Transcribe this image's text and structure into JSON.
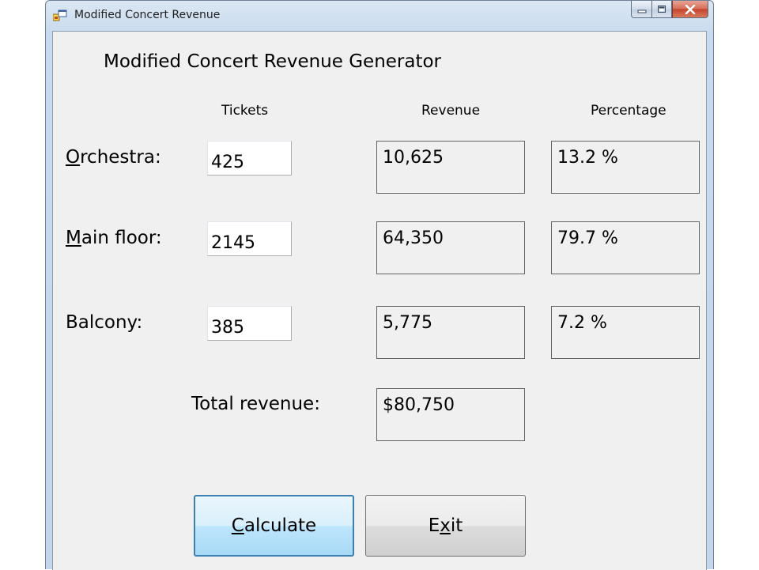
{
  "window": {
    "title": "Modified Concert Revenue"
  },
  "form": {
    "heading": "Modified Concert Revenue Generator",
    "columns": {
      "tickets": "Tickets",
      "revenue": "Revenue",
      "percentage": "Percentage"
    },
    "rows": [
      {
        "label_first": "O",
        "label_rest": "rchestra:",
        "tickets": "425",
        "revenue": "10,625",
        "percentage": "13.2 %"
      },
      {
        "label_first": "M",
        "label_rest": "ain floor:",
        "tickets": "2145",
        "revenue": "64,350",
        "percentage": "79.7 %"
      },
      {
        "label_first": "",
        "label_rest": "Balcony:",
        "tickets": "385",
        "revenue": "5,775",
        "percentage": "7.2 %"
      }
    ],
    "total_label": "Total revenue:",
    "total_value": "$80,750",
    "buttons": {
      "calculate_first": "C",
      "calculate_rest": "alculate",
      "exit_first": "E",
      "exit_mid": "x",
      "exit_rest": "it"
    }
  },
  "colors": {
    "frame": "#c4d6ea",
    "client": "#f0f0f0",
    "close": "#c5432b",
    "focus_button_border": "#3c7fb1"
  },
  "icons": [
    "app-window-icon",
    "minimize-icon",
    "maximize-icon",
    "close-icon"
  ]
}
